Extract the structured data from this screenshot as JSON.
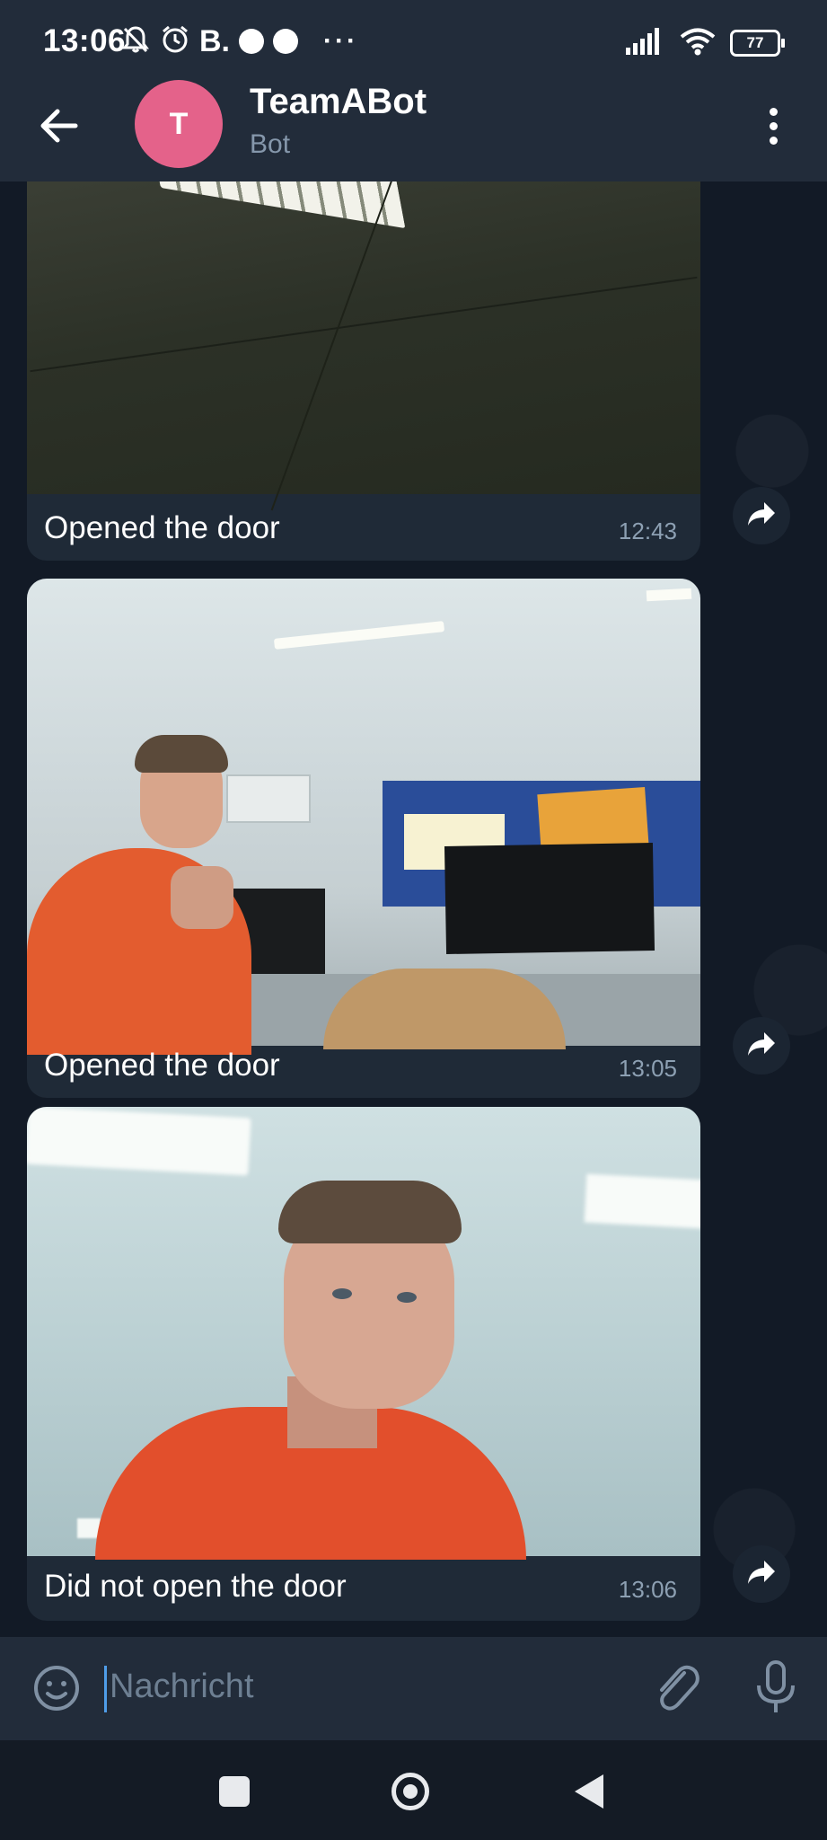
{
  "status_bar": {
    "time": "13:06",
    "carrier_letter": "B.",
    "more": "···",
    "battery": "77"
  },
  "header": {
    "avatar_initial": "T",
    "title": "TeamABot",
    "subtitle": "Bot"
  },
  "messages": [
    {
      "caption": "Opened the door",
      "time": "12:43"
    },
    {
      "caption": "Opened the door",
      "time": "13:05"
    },
    {
      "caption": "Did not open the door",
      "time": "13:06"
    }
  ],
  "input": {
    "placeholder": "Nachricht"
  },
  "colors": {
    "avatar": "#e4628a",
    "bubble": "#1f2a37",
    "header": "#222c3a",
    "accent": "#4f9de8"
  },
  "icons": [
    "mute-bell-icon",
    "alarm-icon",
    "signal-icon",
    "wifi-icon",
    "battery-icon",
    "back-arrow-icon",
    "more-vertical-icon",
    "share-icon",
    "emoji-icon",
    "attach-icon",
    "mic-icon",
    "nav-recents-icon",
    "nav-home-icon",
    "nav-back-icon"
  ]
}
